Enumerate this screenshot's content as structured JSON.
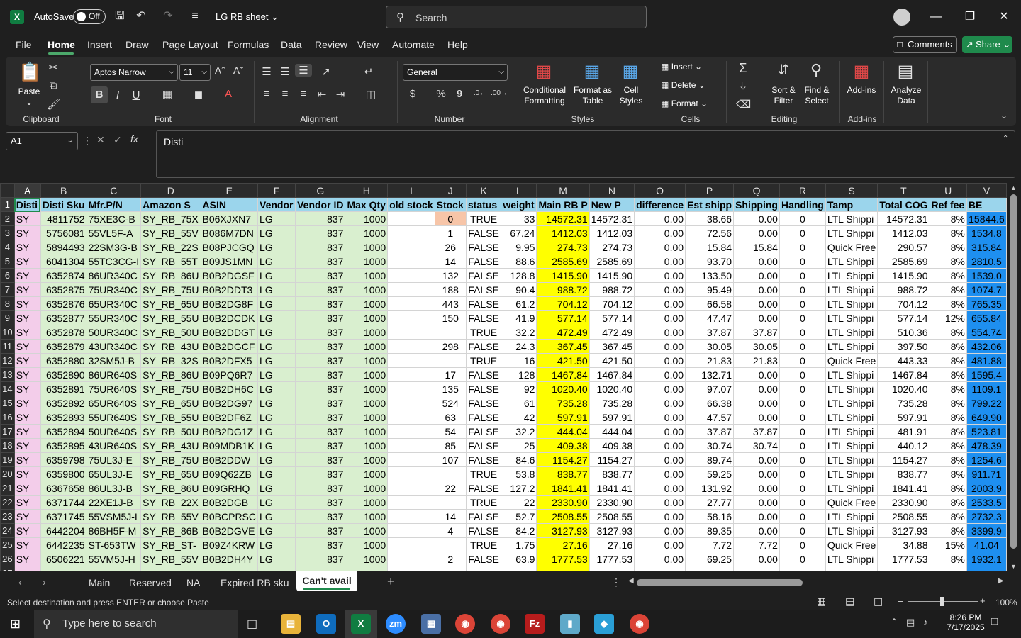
{
  "titlebar": {
    "autosave_label": "AutoSave",
    "autosave_state": "Off",
    "filename": "LG RB sheet",
    "search_placeholder": "Search"
  },
  "menu": {
    "tabs": [
      "File",
      "Home",
      "Insert",
      "Draw",
      "Page Layout",
      "Formulas",
      "Data",
      "Review",
      "View",
      "Automate",
      "Help"
    ],
    "active": "Home",
    "comments": "Comments",
    "share": "Share"
  },
  "ribbon": {
    "clipboard": {
      "paste": "Paste",
      "label": "Clipboard"
    },
    "font": {
      "family": "Aptos Narrow",
      "size": "11",
      "bold": "B",
      "italic": "I",
      "underline": "U",
      "label": "Font"
    },
    "alignment": {
      "label": "Alignment"
    },
    "number": {
      "format": "General",
      "currency": "$",
      "percent": "%",
      "comma": "9",
      "label": "Number"
    },
    "styles": {
      "conditional": "Conditional Formatting",
      "format_table": "Format as Table",
      "cell_styles": "Cell Styles",
      "label": "Styles"
    },
    "cells": {
      "insert": "Insert",
      "delete": "Delete",
      "format": "Format",
      "label": "Cells"
    },
    "editing": {
      "sort": "Sort & Filter",
      "find": "Find & Select",
      "label": "Editing"
    },
    "addins": {
      "addins": "Add-ins",
      "analyze": "Analyze Data",
      "label": "Add-ins"
    }
  },
  "formula_bar": {
    "name_box": "A1",
    "fx": "fx",
    "content": "Disti"
  },
  "columns": [
    "A",
    "B",
    "C",
    "D",
    "E",
    "F",
    "G",
    "H",
    "I",
    "J",
    "K",
    "L",
    "M",
    "N",
    "O",
    "P",
    "Q",
    "R",
    "S",
    "T",
    "U",
    "V"
  ],
  "header_row": [
    "Disti",
    "Disti Sku",
    "Mfr.P/N",
    "Amazon S",
    "ASIN",
    "Vendor",
    "Vendor ID",
    "Max Qty",
    "old stock",
    "Stock",
    "status",
    "weight",
    "Main RB P",
    "New P",
    "difference",
    "Est shipp",
    "Shipping",
    "Handling",
    "Tamp",
    "Total COG",
    "Ref fee",
    "BE"
  ],
  "rows": [
    [
      "SY",
      "4811752",
      "75XE3C-B",
      "SY_RB_75X",
      "B06XJXN7",
      "LG",
      "837",
      "1000",
      "",
      "0",
      "TRUE",
      "33",
      "14572.31",
      "14572.31",
      "0.00",
      "38.66",
      "0.00",
      "0",
      "LTL Shippi",
      "14572.31",
      "8%",
      "15844.6"
    ],
    [
      "SY",
      "5756081",
      "55VL5F-A",
      "SY_RB_55V",
      "B086M7DN",
      "LG",
      "837",
      "1000",
      "",
      "1",
      "FALSE",
      "67.24",
      "1412.03",
      "1412.03",
      "0.00",
      "72.56",
      "0.00",
      "0",
      "LTL Shippi",
      "1412.03",
      "8%",
      "1534.8"
    ],
    [
      "SY",
      "5894493",
      "22SM3G-B",
      "SY_RB_22S",
      "B08PJCGQ",
      "LG",
      "837",
      "1000",
      "",
      "26",
      "FALSE",
      "9.95",
      "274.73",
      "274.73",
      "0.00",
      "15.84",
      "15.84",
      "0",
      "Quick Free",
      "290.57",
      "8%",
      "315.84"
    ],
    [
      "SY",
      "6041304",
      "55TC3CG-I",
      "SY_RB_55T",
      "B09JS1MN",
      "LG",
      "837",
      "1000",
      "",
      "14",
      "FALSE",
      "88.6",
      "2585.69",
      "2585.69",
      "0.00",
      "93.70",
      "0.00",
      "0",
      "LTL Shippi",
      "2585.69",
      "8%",
      "2810.5"
    ],
    [
      "SY",
      "6352874",
      "86UR340C",
      "SY_RB_86U",
      "B0B2DGSF",
      "LG",
      "837",
      "1000",
      "",
      "132",
      "FALSE",
      "128.8",
      "1415.90",
      "1415.90",
      "0.00",
      "133.50",
      "0.00",
      "0",
      "LTL Shippi",
      "1415.90",
      "8%",
      "1539.0"
    ],
    [
      "SY",
      "6352875",
      "75UR340C",
      "SY_RB_75U",
      "B0B2DDT3",
      "LG",
      "837",
      "1000",
      "",
      "188",
      "FALSE",
      "90.4",
      "988.72",
      "988.72",
      "0.00",
      "95.49",
      "0.00",
      "0",
      "LTL Shippi",
      "988.72",
      "8%",
      "1074.7"
    ],
    [
      "SY",
      "6352876",
      "65UR340C",
      "SY_RB_65U",
      "B0B2DG8F",
      "LG",
      "837",
      "1000",
      "",
      "443",
      "FALSE",
      "61.2",
      "704.12",
      "704.12",
      "0.00",
      "66.58",
      "0.00",
      "0",
      "LTL Shippi",
      "704.12",
      "8%",
      "765.35"
    ],
    [
      "SY",
      "6352877",
      "55UR340C",
      "SY_RB_55U",
      "B0B2DCDK",
      "LG",
      "837",
      "1000",
      "",
      "150",
      "FALSE",
      "41.9",
      "577.14",
      "577.14",
      "0.00",
      "47.47",
      "0.00",
      "0",
      "LTL Shippi",
      "577.14",
      "12%",
      "655.84"
    ],
    [
      "SY",
      "6352878",
      "50UR340C",
      "SY_RB_50U",
      "B0B2DDGT",
      "LG",
      "837",
      "1000",
      "",
      "",
      "TRUE",
      "32.2",
      "472.49",
      "472.49",
      "0.00",
      "37.87",
      "37.87",
      "0",
      "LTL Shippi",
      "510.36",
      "8%",
      "554.74"
    ],
    [
      "SY",
      "6352879",
      "43UR340C",
      "SY_RB_43U",
      "B0B2DGCF",
      "LG",
      "837",
      "1000",
      "",
      "298",
      "FALSE",
      "24.3",
      "367.45",
      "367.45",
      "0.00",
      "30.05",
      "30.05",
      "0",
      "LTL Shippi",
      "397.50",
      "8%",
      "432.06"
    ],
    [
      "SY",
      "6352880",
      "32SM5J-B",
      "SY_RB_32S",
      "B0B2DFX5",
      "LG",
      "837",
      "1000",
      "",
      "",
      "TRUE",
      "16",
      "421.50",
      "421.50",
      "0.00",
      "21.83",
      "21.83",
      "0",
      "Quick Free",
      "443.33",
      "8%",
      "481.88"
    ],
    [
      "SY",
      "6352890",
      "86UR640S",
      "SY_RB_86U",
      "B09PQ6R7",
      "LG",
      "837",
      "1000",
      "",
      "17",
      "FALSE",
      "128",
      "1467.84",
      "1467.84",
      "0.00",
      "132.71",
      "0.00",
      "0",
      "LTL Shippi",
      "1467.84",
      "8%",
      "1595.4"
    ],
    [
      "SY",
      "6352891",
      "75UR640S",
      "SY_RB_75U",
      "B0B2DH6C",
      "LG",
      "837",
      "1000",
      "",
      "135",
      "FALSE",
      "92",
      "1020.40",
      "1020.40",
      "0.00",
      "97.07",
      "0.00",
      "0",
      "LTL Shippi",
      "1020.40",
      "8%",
      "1109.1"
    ],
    [
      "SY",
      "6352892",
      "65UR640S",
      "SY_RB_65U",
      "B0B2DG97",
      "LG",
      "837",
      "1000",
      "",
      "524",
      "FALSE",
      "61",
      "735.28",
      "735.28",
      "0.00",
      "66.38",
      "0.00",
      "0",
      "LTL Shippi",
      "735.28",
      "8%",
      "799.22"
    ],
    [
      "SY",
      "6352893",
      "55UR640S",
      "SY_RB_55U",
      "B0B2DF6Z",
      "LG",
      "837",
      "1000",
      "",
      "63",
      "FALSE",
      "42",
      "597.91",
      "597.91",
      "0.00",
      "47.57",
      "0.00",
      "0",
      "LTL Shippi",
      "597.91",
      "8%",
      "649.90"
    ],
    [
      "SY",
      "6352894",
      "50UR640S",
      "SY_RB_50U",
      "B0B2DG1Z",
      "LG",
      "837",
      "1000",
      "",
      "54",
      "FALSE",
      "32.2",
      "444.04",
      "444.04",
      "0.00",
      "37.87",
      "37.87",
      "0",
      "LTL Shippi",
      "481.91",
      "8%",
      "523.81"
    ],
    [
      "SY",
      "6352895",
      "43UR640S",
      "SY_RB_43U",
      "B09MDB1K",
      "LG",
      "837",
      "1000",
      "",
      "85",
      "FALSE",
      "25",
      "409.38",
      "409.38",
      "0.00",
      "30.74",
      "30.74",
      "0",
      "LTL Shippi",
      "440.12",
      "8%",
      "478.39"
    ],
    [
      "SY",
      "6359798",
      "75UL3J-E",
      "SY_RB_75U",
      "B0B2DDW",
      "LG",
      "837",
      "1000",
      "",
      "107",
      "FALSE",
      "84.6",
      "1154.27",
      "1154.27",
      "0.00",
      "89.74",
      "0.00",
      "0",
      "LTL Shippi",
      "1154.27",
      "8%",
      "1254.6"
    ],
    [
      "SY",
      "6359800",
      "65UL3J-E",
      "SY_RB_65U",
      "B09Q62ZB",
      "LG",
      "837",
      "1000",
      "",
      "",
      "TRUE",
      "53.8",
      "838.77",
      "838.77",
      "0.00",
      "59.25",
      "0.00",
      "0",
      "LTL Shippi",
      "838.77",
      "8%",
      "911.71"
    ],
    [
      "SY",
      "6367658",
      "86UL3J-B",
      "SY_RB_86U",
      "B09GRHQ",
      "LG",
      "837",
      "1000",
      "",
      "22",
      "FALSE",
      "127.2",
      "1841.41",
      "1841.41",
      "0.00",
      "131.92",
      "0.00",
      "0",
      "LTL Shippi",
      "1841.41",
      "8%",
      "2003.9"
    ],
    [
      "SY",
      "6371744",
      "22XE1J-B",
      "SY_RB_22X",
      "B0B2DGB",
      "LG",
      "837",
      "1000",
      "",
      "",
      "TRUE",
      "22",
      "2330.90",
      "2330.90",
      "0.00",
      "27.77",
      "0.00",
      "0",
      "Quick Free",
      "2330.90",
      "8%",
      "2533.5"
    ],
    [
      "SY",
      "6371745",
      "55VSM5J-I",
      "SY_RB_55V",
      "B0BCPRSC",
      "LG",
      "837",
      "1000",
      "",
      "14",
      "FALSE",
      "52.7",
      "2508.55",
      "2508.55",
      "0.00",
      "58.16",
      "0.00",
      "0",
      "LTL Shippi",
      "2508.55",
      "8%",
      "2732.3"
    ],
    [
      "SY",
      "6442204",
      "86BH5F-M",
      "SY_RB_86B",
      "B0B2DGVE",
      "LG",
      "837",
      "1000",
      "",
      "4",
      "FALSE",
      "84.2",
      "3127.93",
      "3127.93",
      "0.00",
      "89.35",
      "0.00",
      "0",
      "LTL Shippi",
      "3127.93",
      "8%",
      "3399.9"
    ],
    [
      "SY",
      "6442235",
      "ST-653TW",
      "SY_RB_ST-",
      "B09Z4KRW",
      "LG",
      "837",
      "1000",
      "",
      "",
      "TRUE",
      "1.75",
      "27.16",
      "27.16",
      "0.00",
      "7.72",
      "7.72",
      "0",
      "Quick Free",
      "34.88",
      "15%",
      "41.04"
    ],
    [
      "SY",
      "6506221",
      "55VM5J-H",
      "SY_RB_55V",
      "B0B2DH4Y",
      "LG",
      "837",
      "1000",
      "",
      "2",
      "FALSE",
      "63.9",
      "1777.53",
      "1777.53",
      "0.00",
      "69.25",
      "0.00",
      "0",
      "LTL Shippi",
      "1777.53",
      "8%",
      "1932.1"
    ]
  ],
  "sheet_tabs": [
    "Main",
    "Reserved",
    "NA",
    "Expired RB sku",
    "Can't avail"
  ],
  "active_sheet": "Can't avail",
  "status": {
    "message": "Select destination and press ENTER or choose Paste",
    "zoom": "100%"
  },
  "taskbar": {
    "search_placeholder": "Type here to search",
    "time": "8:26 PM",
    "date": "7/17/2025"
  },
  "colors": {
    "excel_green": "#1f8a4c",
    "header_fill": "#9bd5ec",
    "disti_fill": "#f3cdea",
    "sku_fill": "#d9efcf",
    "main_rb_fill": "#ffff00",
    "be_fill": "#1e8ff0"
  }
}
